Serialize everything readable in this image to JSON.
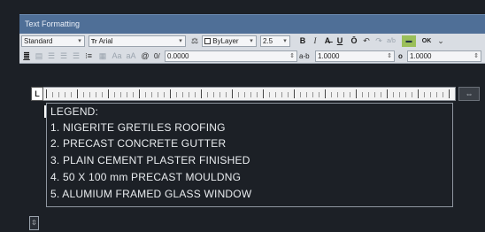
{
  "window": {
    "title": "Text Formatting"
  },
  "toolbar": {
    "style_value": "Standard",
    "font_value": "Arial",
    "color_value": "ByLayer",
    "height_value": "2.5",
    "bold_label": "B",
    "italic_label": "I",
    "underline_label": "U",
    "overline_label": "Ō",
    "undo_label": "↶",
    "redo_label": "↷",
    "stack_label": "a/b",
    "ok_label": "OK",
    "oblique_value": "0.0000",
    "tracking_value": "1.0000",
    "width_value": "1.0000",
    "oblique_prefix": "0/",
    "tracking_prefix": "a-b",
    "width_prefix": "o"
  },
  "ruler": {
    "tab_button_label": "L",
    "end_button_label": "⇔"
  },
  "text_lines": [
    "LEGEND:",
    "1. NIGERITE GRETILES ROOFING",
    "2. PRECAST CONCRETE GUTTER",
    "3. PLAIN CEMENT PLASTER FINISHED",
    "4. 50 X 100 mm PRECAST MOULDNG",
    "5. ALUMIUM FRAMED GLASS WINDOW"
  ],
  "resize_handle_label": "⇳",
  "colors": {
    "background": "#1c2026",
    "titlebar": "#4f6f97",
    "toolbar": "#d9dde3",
    "text": "#e9ecef"
  }
}
